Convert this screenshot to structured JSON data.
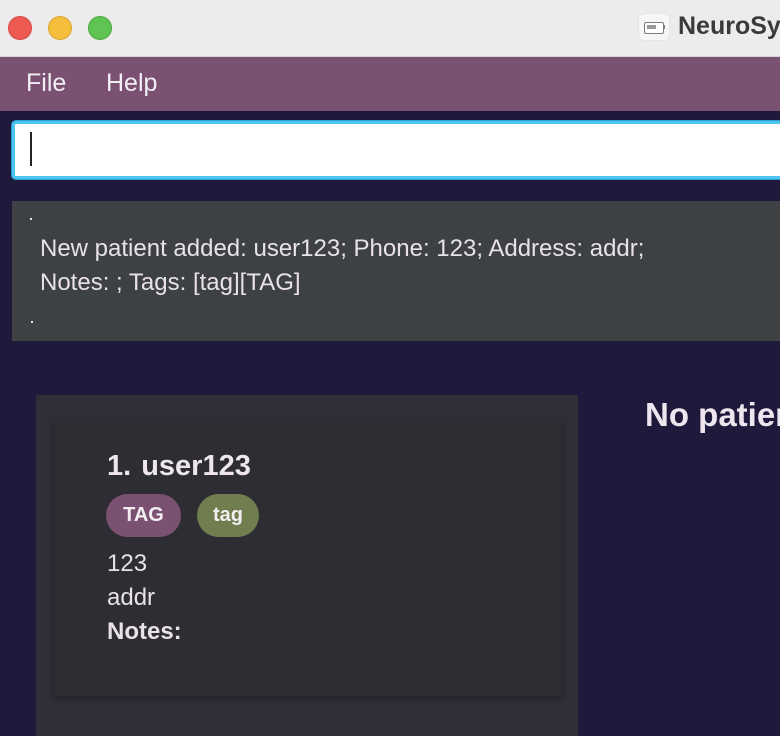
{
  "window": {
    "title": "NeuroSy"
  },
  "menu": {
    "items": [
      "File",
      "Help"
    ]
  },
  "command_box": {
    "value": "",
    "placeholder": ""
  },
  "result_display": {
    "text": "New patient added: user123; Phone: 123; Address: addr;\nNotes: ; Tags: [tag][TAG]"
  },
  "patient_list": {
    "patients": [
      {
        "index": "1.",
        "name": "user123",
        "tags": [
          {
            "label": "TAG",
            "color": "#7a5170"
          },
          {
            "label": "tag",
            "color": "#6f7d4f"
          }
        ],
        "phone": "123",
        "address": "addr",
        "notes_label": "Notes:"
      }
    ]
  },
  "detail_panel": {
    "placeholder": "No patien"
  },
  "colors": {
    "background": "#1f1a3b",
    "menubar": "#7a5170",
    "result_bg": "#3e4144",
    "accent_focus": "#4cc4ef"
  }
}
